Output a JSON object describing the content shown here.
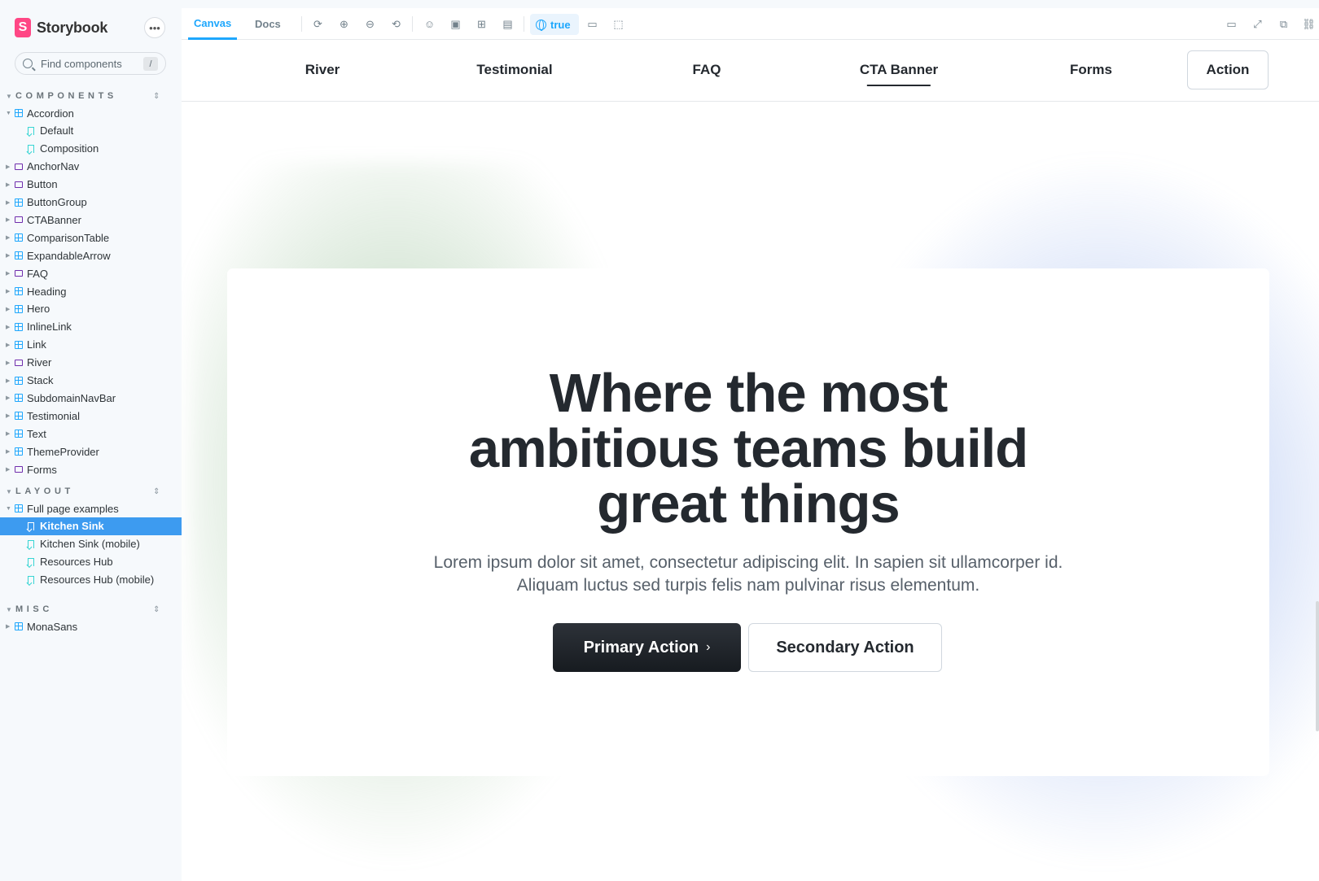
{
  "brand": {
    "name": "Storybook",
    "logo_letter": "S",
    "accent": "#ff4785"
  },
  "search": {
    "placeholder": "Find components",
    "shortcut": "/"
  },
  "sidebar": {
    "sections": [
      {
        "label": "COMPONENTS",
        "items": [
          {
            "label": "Accordion",
            "type": "component",
            "expanded": true
          },
          {
            "label": "Default",
            "type": "story"
          },
          {
            "label": "Composition",
            "type": "story"
          },
          {
            "label": "AnchorNav",
            "type": "folder"
          },
          {
            "label": "Button",
            "type": "folder"
          },
          {
            "label": "ButtonGroup",
            "type": "component"
          },
          {
            "label": "CTABanner",
            "type": "folder"
          },
          {
            "label": "ComparisonTable",
            "type": "component"
          },
          {
            "label": "ExpandableArrow",
            "type": "component"
          },
          {
            "label": "FAQ",
            "type": "folder"
          },
          {
            "label": "Heading",
            "type": "component"
          },
          {
            "label": "Hero",
            "type": "component"
          },
          {
            "label": "InlineLink",
            "type": "component"
          },
          {
            "label": "Link",
            "type": "component"
          },
          {
            "label": "River",
            "type": "folder"
          },
          {
            "label": "Stack",
            "type": "component"
          },
          {
            "label": "SubdomainNavBar",
            "type": "component"
          },
          {
            "label": "Testimonial",
            "type": "component"
          },
          {
            "label": "Text",
            "type": "component"
          },
          {
            "label": "ThemeProvider",
            "type": "component"
          },
          {
            "label": "Forms",
            "type": "folder"
          }
        ]
      },
      {
        "label": "LAYOUT",
        "items": [
          {
            "label": "Full page examples",
            "type": "component",
            "expanded": true
          },
          {
            "label": "Kitchen Sink",
            "type": "story",
            "selected": true
          },
          {
            "label": "Kitchen Sink (mobile)",
            "type": "story"
          },
          {
            "label": "Resources Hub",
            "type": "story"
          },
          {
            "label": "Resources Hub (mobile)",
            "type": "story"
          }
        ]
      },
      {
        "label": "MISC",
        "items": [
          {
            "label": "MonaSans",
            "type": "component"
          }
        ]
      }
    ]
  },
  "toolbar": {
    "tabs": [
      {
        "label": "Canvas",
        "active": true
      },
      {
        "label": "Docs",
        "active": false
      }
    ],
    "locale_label": "true",
    "left_icons": [
      "reload-icon",
      "zoom-in-icon",
      "zoom-out-icon",
      "zoom-reset-icon",
      "accessibility-icon",
      "background-icon",
      "grid-icon",
      "outline-icon"
    ],
    "right_icons": [
      "panel-icon",
      "fullscreen-icon",
      "open-new-tab-icon",
      "copy-link-icon"
    ]
  },
  "preview": {
    "subnav": {
      "links": [
        {
          "label": "River",
          "current": false
        },
        {
          "label": "Testimonial",
          "current": false
        },
        {
          "label": "FAQ",
          "current": false
        },
        {
          "label": "CTA Banner",
          "current": true
        },
        {
          "label": "Forms",
          "current": false
        }
      ],
      "action_label": "Action"
    },
    "cta": {
      "title": "Where the most ambitious teams build great things",
      "body": "Lorem ipsum dolor sit amet, consectetur adipiscing elit. In sapien sit ullamcorper id. Aliquam luctus sed turpis felis nam pulvinar risus elementum.",
      "primary_label": "Primary Action",
      "secondary_label": "Secondary Action"
    }
  },
  "colors": {
    "selected": "#3d9bf0",
    "toolbar_active": "#1ea7fd",
    "component_icon": "#1ea7fd",
    "folder_icon": "#6f2cac",
    "story_icon": "#37d5d3"
  }
}
